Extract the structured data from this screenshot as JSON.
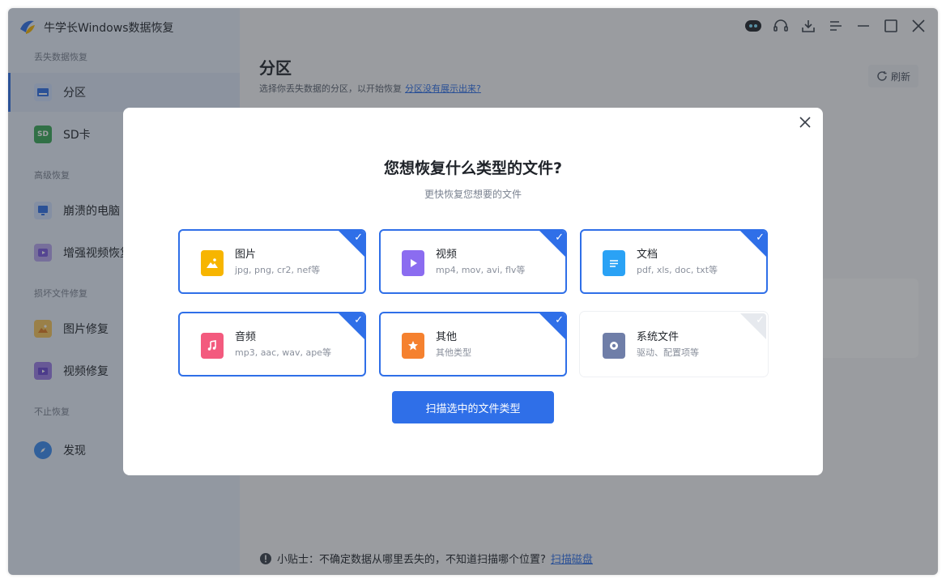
{
  "app": {
    "title": "牛学长Windows数据恢复"
  },
  "sidebar": {
    "sections": [
      {
        "label": "丢失数据恢复"
      },
      {
        "label": "高级恢复"
      },
      {
        "label": "损坏文件修复"
      },
      {
        "label": "不止恢复"
      }
    ],
    "items": [
      {
        "label": "分区",
        "icon": "partition-icon",
        "active": true
      },
      {
        "label": "SD卡",
        "icon": "sd-card-icon"
      },
      {
        "label": "崩溃的电脑",
        "icon": "crashed-pc-icon"
      },
      {
        "label": "增强视频恢复",
        "icon": "enhanced-video-icon"
      },
      {
        "label": "图片修复",
        "icon": "photo-repair-icon"
      },
      {
        "label": "视频修复",
        "icon": "video-repair-icon"
      },
      {
        "label": "发现",
        "icon": "compass-icon"
      }
    ]
  },
  "main": {
    "title": "分区",
    "subtitle": "选择你丢失数据的分区，以开始恢复",
    "subtitle_link": "分区没有展示出来?",
    "refresh_label": "刷新",
    "tip_text": "小贴士：不确定数据从哪里丢失的，不知道扫描哪个位置?",
    "tip_link": "扫描磁盘"
  },
  "modal": {
    "title": "您想恢复什么类型的文件?",
    "subtitle": "更快恢复您想要的文件",
    "types": [
      {
        "name": "图片",
        "desc": "jpg, png, cr2, nef等",
        "checked": true,
        "color": "#f7b500",
        "icon": "image-file-icon"
      },
      {
        "name": "视频",
        "desc": "mp4, mov, avi, flv等",
        "checked": true,
        "color": "#8b6cf0",
        "icon": "video-file-icon"
      },
      {
        "name": "文档",
        "desc": "pdf, xls, doc, txt等",
        "checked": true,
        "color": "#2aa2f5",
        "icon": "document-file-icon"
      },
      {
        "name": "音频",
        "desc": "mp3, aac, wav, ape等",
        "checked": true,
        "color": "#f35a7e",
        "icon": "audio-file-icon"
      },
      {
        "name": "其他",
        "desc": "其他类型",
        "checked": true,
        "color": "#f5812f",
        "icon": "other-file-icon"
      },
      {
        "name": "系统文件",
        "desc": "驱动、配置项等",
        "checked": false,
        "color": "#6f7ea8",
        "icon": "system-file-icon"
      }
    ],
    "scan_button": "扫描选中的文件类型"
  },
  "colors": {
    "accent": "#2f6fe8",
    "sidebar_bg": "#e9f0fb"
  }
}
